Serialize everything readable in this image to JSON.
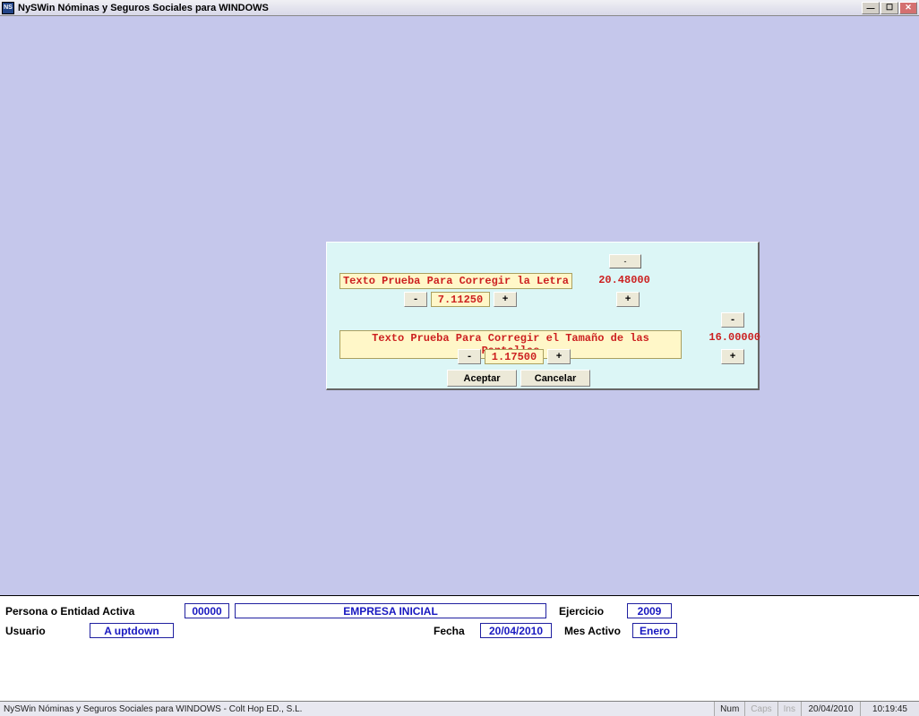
{
  "window": {
    "title": "NySWin Nóminas y Seguros Sociales para WINDOWS",
    "icon_text": "NS"
  },
  "dialog": {
    "topbox": "-",
    "letter": {
      "banner": "Texto Prueba Para Corregir la Letra",
      "minus": "-",
      "value": "7.11250",
      "plus": "+",
      "side_value": "20.48000",
      "side_plus": "+"
    },
    "screen": {
      "banner": "Texto Prueba Para Corregir el Tamaño de las Pantallas",
      "minus": "-",
      "value": "1.17500",
      "plus": "+",
      "side_minus": "-",
      "side_value": "16.00000",
      "side_plus": "+"
    },
    "accept": "Aceptar",
    "cancel": "Cancelar"
  },
  "info": {
    "entity_label": "Persona o Entidad Activa",
    "entity_code": "00000",
    "entity_name": "EMPRESA INICIAL",
    "ejercicio_label": "Ejercicio",
    "ejercicio_value": "2009",
    "usuario_label": "Usuario",
    "usuario_value": "A uptdown",
    "fecha_label": "Fecha",
    "fecha_value": "20/04/2010",
    "mes_label": "Mes Activo",
    "mes_value": "Enero"
  },
  "status": {
    "text": "NySWin Nóminas y Seguros Sociales para WINDOWS - Colt Hop ED., S.L.",
    "num": "Num",
    "caps": "Caps",
    "ins": "Ins",
    "date": "20/04/2010",
    "time": "10:19:45"
  }
}
